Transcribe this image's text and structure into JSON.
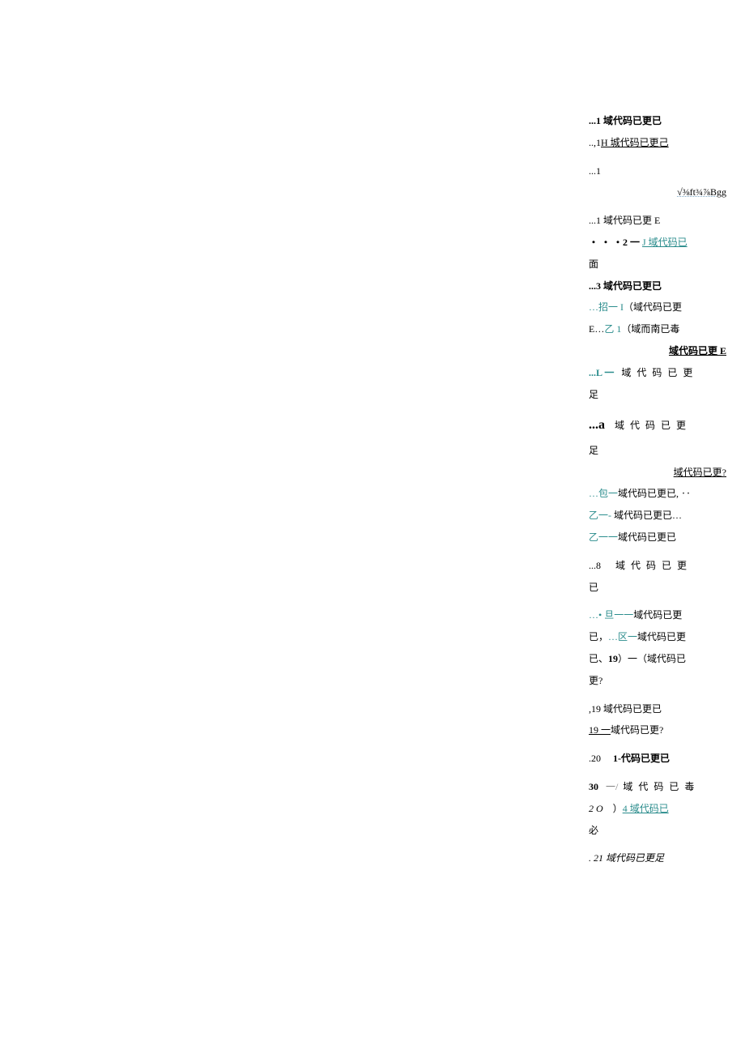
{
  "lines": {
    "l1": "...1 域代码已更已",
    "l2a": "..,1",
    "l2b": "H 城代码已更己",
    "l3": "...1",
    "l4": "√⅜ft¾⅞Bgg",
    "l5": "...1 域代码已更 E",
    "l6a": "・ ・ ・2 一 ",
    "l6b": "J 域代码已",
    "l7": "面",
    "l8": "...3 域代码已更已",
    "l9a": "…招一 I",
    "l9b": "（域代码已更",
    "l10a": "E…",
    "l10b": "乙 1",
    "l10c": "（域而南已毒",
    "l11": "域代码已更 E",
    "l12a": "...L 一",
    "l12b": "域 代 码 已 更",
    "l13": "足",
    "l14a": "...a",
    "l14b": "域 代 码 已 更",
    "l15": "足",
    "l16": "域代码已更?",
    "l17a": "…包一",
    "l17b": "域代码已更已, ‥",
    "l18a": "乙一-",
    "l18b": "域代码已更已…",
    "l19a": "乙一一",
    "l19b": "域代码已更已",
    "l20a": "...8",
    "l20b": "域 代 码 已 更",
    "l21": "已",
    "l22a": "…• 旦一一",
    "l22b": "域代码已更",
    "l23a": "已，",
    "l23b": "…区一",
    "l23c": "域代码已更",
    "l24a": "已、",
    "l24b": "19",
    "l24c": "）一（域代码已",
    "l25": "更?",
    "l26": ",19 域代码已更已",
    "l27a": "19 一",
    "l27b": "域代码已更?",
    "l28a": ".20",
    "l28b": "1-代码已更已",
    "l29a": "30",
    "l29b": "一/",
    "l29c": "域 代 码 已 毒",
    "l30a": "2 O",
    "l30b": "）",
    "l30c": "4 域代码已",
    "l31": "必",
    "l32": ". 21 域代码已更足"
  }
}
